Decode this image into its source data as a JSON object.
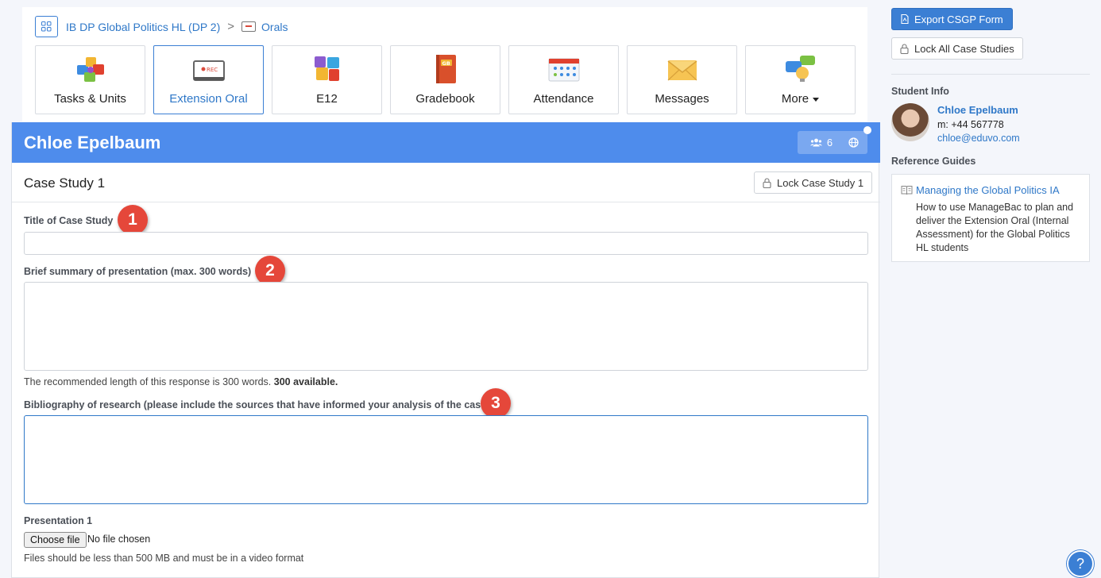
{
  "breadcrumb": {
    "class_name": "IB DP Global Politics HL (DP 2)",
    "separator": ">",
    "section": "Orals"
  },
  "tiles": [
    {
      "label": "Tasks & Units",
      "icon": "puzzle-pieces-icon"
    },
    {
      "label": "Extension Oral",
      "icon": "rec-screen-icon",
      "active": true
    },
    {
      "label": "E12",
      "icon": "puzzle-icon"
    },
    {
      "label": "Gradebook",
      "icon": "gradebook-icon"
    },
    {
      "label": "Attendance",
      "icon": "calendar-icon"
    },
    {
      "label": "Messages",
      "icon": "envelope-icon"
    },
    {
      "label": "More",
      "icon": "chat-bulb-icon"
    }
  ],
  "student_header": {
    "name": "Chloe Epelbaum",
    "group_count": "6"
  },
  "case_study": {
    "title": "Case Study 1",
    "lock_label": "Lock Case Study 1"
  },
  "form": {
    "title_label": "Title of Case Study",
    "title_value": "",
    "summary_label": "Brief summary of presentation (max. 300 words)",
    "summary_value": "",
    "summary_help": "The recommended length of this response is 300 words.",
    "summary_available": "300 available.",
    "bibliography_label": "Bibliography of research (please include the sources that have informed your analysis of the case)",
    "bibliography_value": "",
    "presentation_label": "Presentation 1",
    "choose_file": "Choose file",
    "no_file": "No file chosen",
    "file_help": "Files should be less than 500 MB and must be in a video format"
  },
  "annotations": [
    "1",
    "2",
    "3"
  ],
  "sidebar": {
    "export_label": "Export CSGP Form",
    "lock_all_label": "Lock All Case Studies",
    "student_info_heading": "Student Info",
    "student_name": "Chloe Epelbaum",
    "student_phone": "m: +44 567778",
    "student_email": "chloe@eduvo.com",
    "reference_heading": "Reference Guides",
    "guide_title": "Managing the Global Politics IA",
    "guide_description": "How to use ManageBac to plan and deliver the Extension Oral (Internal Assessment) for the Global Politics HL students"
  },
  "help_button": "?",
  "colors": {
    "primary": "#3b7fd4",
    "header_blue": "#4e8cec",
    "annotation_red": "#e5473a"
  }
}
